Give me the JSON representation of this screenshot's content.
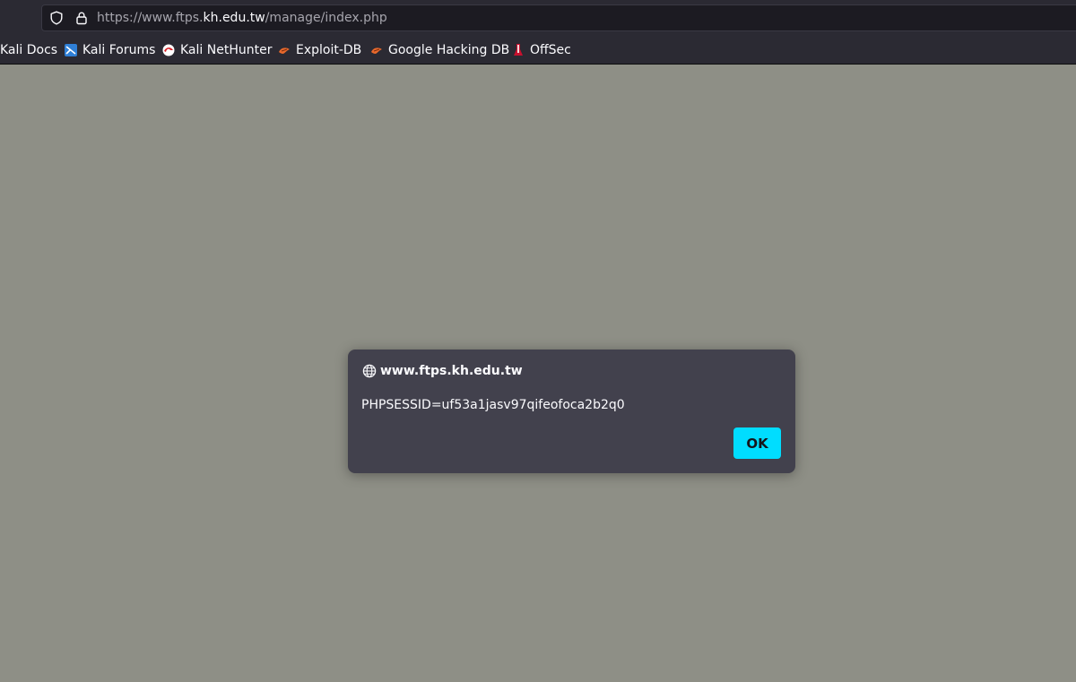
{
  "browser": {
    "url_prefix": "https://www.ftps.",
    "url_host": "kh.edu.tw",
    "url_path": "/manage/index.php"
  },
  "bookmarks": [
    {
      "label": "Kali Docs",
      "icon": "kali-docs-icon"
    },
    {
      "label": "Kali Forums",
      "icon": "kali-forums-icon"
    },
    {
      "label": "Kali NetHunter",
      "icon": "kali-nethunter-icon"
    },
    {
      "label": "Exploit-DB",
      "icon": "exploit-db-icon"
    },
    {
      "label": "Google Hacking DB",
      "icon": "google-hacking-db-icon"
    },
    {
      "label": "OffSec",
      "icon": "offsec-icon"
    }
  ],
  "dialog": {
    "origin": "www.ftps.kh.edu.tw",
    "message": "PHPSESSID=uf53a1jasv97qifeofoca2b2q0",
    "ok_label": "OK"
  },
  "colors": {
    "page_background": "#8e8f86",
    "chrome": "#2b2a33",
    "dialog": "#42414d",
    "accent": "#00ddff"
  }
}
